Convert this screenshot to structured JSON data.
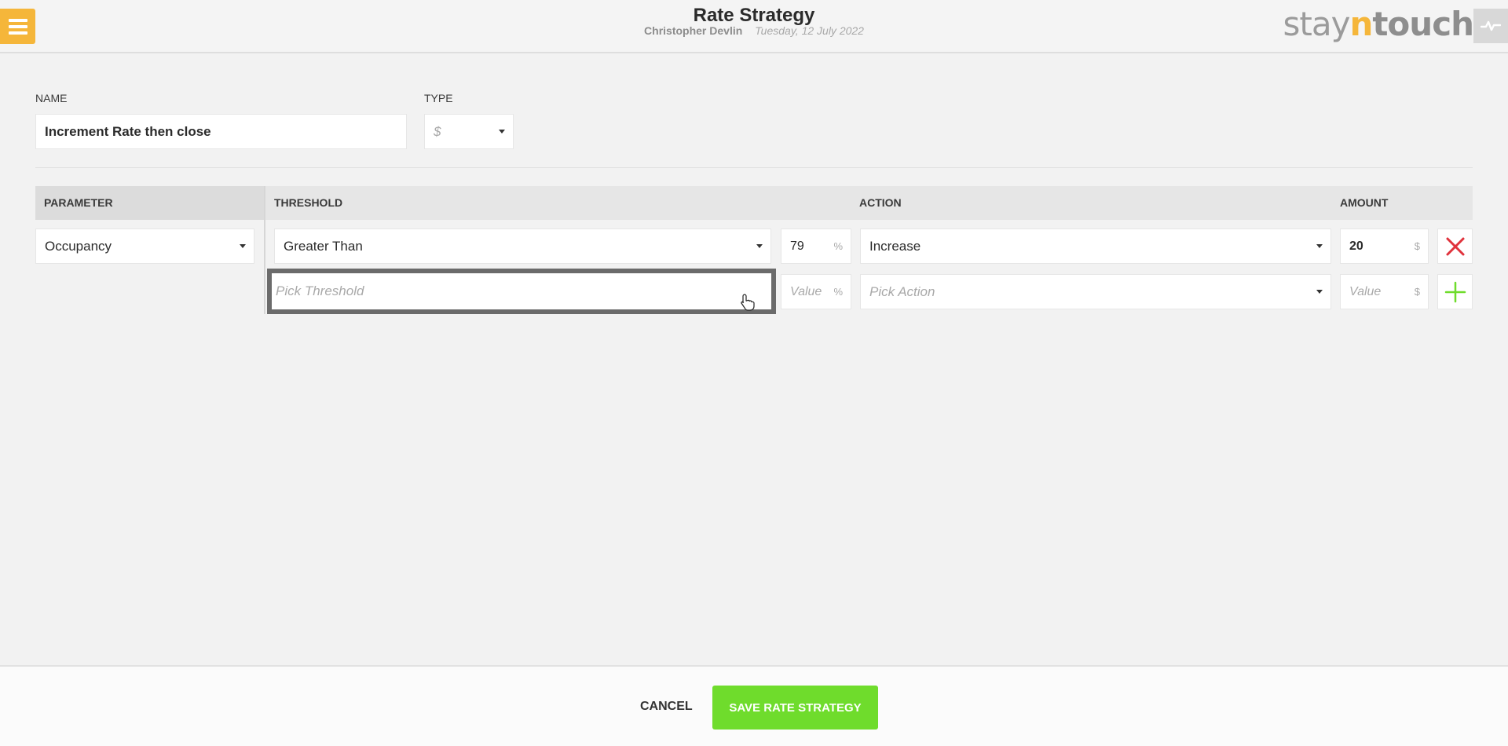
{
  "header": {
    "title": "Rate Strategy",
    "user": "Christopher Devlin",
    "date": "Tuesday, 12 July 2022",
    "logo": {
      "stay": "stay",
      "n": "n",
      "touch": "touch"
    }
  },
  "form": {
    "name_label": "NAME",
    "name_value": "Increment Rate then close",
    "type_label": "TYPE",
    "type_value": "$"
  },
  "table": {
    "headers": {
      "parameter": "PARAMETER",
      "threshold": "THRESHOLD",
      "action": "ACTION",
      "amount": "AMOUNT"
    },
    "rows": [
      {
        "parameter": "Occupancy",
        "threshold": "Greater Than",
        "threshold_value": "79",
        "threshold_unit": "%",
        "action": "Increase",
        "amount": "20",
        "amount_unit": "$"
      }
    ],
    "new_row": {
      "threshold_placeholder": "Pick Threshold",
      "value_placeholder": "Value",
      "threshold_unit": "%",
      "action_placeholder": "Pick Action",
      "amount_placeholder": "Value",
      "amount_unit": "$"
    }
  },
  "footer": {
    "cancel_label": "CANCEL",
    "save_label": "SAVE RATE STRATEGY"
  },
  "colors": {
    "menu": "#f5b63a",
    "save": "#6fdc2c",
    "delete": "#e0323c",
    "add": "#6fdc2c"
  },
  "icons": [
    "menu-icon",
    "activity-icon",
    "caret-down-icon",
    "close-icon",
    "plus-icon",
    "pointer-cursor-icon"
  ]
}
